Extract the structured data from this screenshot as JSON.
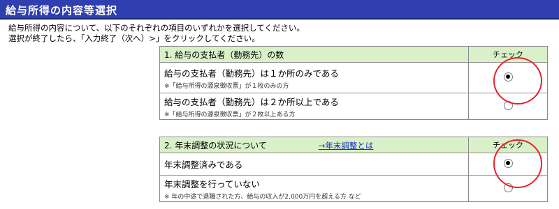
{
  "title": "給与所得の内容等選択",
  "instructions": [
    "給与所得の内容について、以下のそれぞれの項目のいずれかを選択してください。",
    "選択が終了したら、「入力終了（次へ）>」をクリックしてください。"
  ],
  "section1": {
    "header": "1. 給与の支払者（勤務先）の数",
    "check_label": "チェック",
    "options": [
      {
        "label": "給与の支払者（勤務先）は１か所のみである",
        "note": "※「給与所得の源泉徴収票」が１枚のみの方",
        "selected": true
      },
      {
        "label": "給与の支払者（勤務先）は２か所以上である",
        "note": "※「給与所得の源泉徴収票」が２枚以上ある方",
        "selected": false
      }
    ]
  },
  "section2": {
    "header": "2. 年末調整の状況について",
    "help_link": "→年末調整とは",
    "check_label": "チェック",
    "options": [
      {
        "label": "年末調整済みである",
        "note": "",
        "selected": true
      },
      {
        "label": "年末調整を行っていない",
        "note": "※ 年の中途で退職された方、給与の収入が2,000万円を超える方 など",
        "selected": false
      }
    ]
  },
  "colors": {
    "title_bar": "#2f3fb0",
    "header_bg": "#d9f0c8",
    "annotation": "#e8202a"
  }
}
